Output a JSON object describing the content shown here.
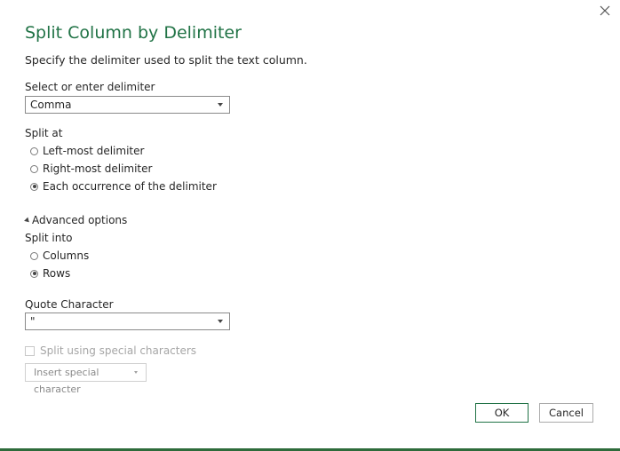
{
  "dialog": {
    "title": "Split Column by Delimiter",
    "subtitle": "Specify the delimiter used to split the text column.",
    "close_icon": "close-icon"
  },
  "delimiter": {
    "label": "Select or enter delimiter",
    "value": "Comma"
  },
  "split_at": {
    "label": "Split at",
    "options": [
      {
        "label": "Left-most delimiter",
        "checked": false
      },
      {
        "label": "Right-most delimiter",
        "checked": false
      },
      {
        "label": "Each occurrence of the delimiter",
        "checked": true
      }
    ]
  },
  "advanced": {
    "toggle_label": "Advanced options",
    "split_into_label": "Split into",
    "split_into_options": [
      {
        "label": "Columns",
        "checked": false
      },
      {
        "label": "Rows",
        "checked": true
      }
    ],
    "quote_label": "Quote Character",
    "quote_value": "\""
  },
  "special": {
    "checkbox_label": "Split using special characters",
    "checkbox_checked": false,
    "insert_label": "Insert special character"
  },
  "footer": {
    "ok_label": "OK",
    "cancel_label": "Cancel"
  },
  "colors": {
    "accent": "#217346",
    "bottom_border": "#2e6b3b",
    "disabled_text": "#a6a6a6"
  }
}
